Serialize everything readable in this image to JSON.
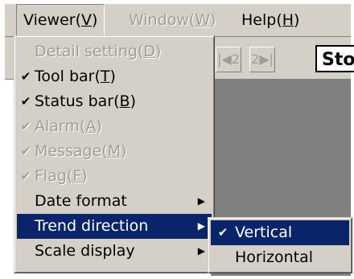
{
  "menubar": {
    "items": [
      {
        "label": "Viewer",
        "key": "V"
      },
      {
        "label": "Window",
        "key": "W"
      },
      {
        "label": "Help",
        "key": "H"
      }
    ]
  },
  "toolbar": {
    "nav_prev_label": "2",
    "nav_next_label": "2",
    "status_box_text": "Sto"
  },
  "viewer_menu": {
    "items": [
      {
        "label": "Detail setting",
        "key": "D",
        "checked": false,
        "enabled": false,
        "submenu": false
      },
      {
        "label": "Tool bar",
        "key": "T",
        "checked": true,
        "enabled": true,
        "submenu": false
      },
      {
        "label": "Status bar",
        "key": "B",
        "checked": true,
        "enabled": true,
        "submenu": false
      },
      {
        "label": "Alarm",
        "key": "A",
        "checked": true,
        "enabled": false,
        "submenu": false
      },
      {
        "label": "Message",
        "key": "M",
        "checked": true,
        "enabled": false,
        "submenu": false
      },
      {
        "label": "Flag",
        "key": "F",
        "checked": true,
        "enabled": false,
        "submenu": false
      },
      {
        "label": "Date format",
        "key": "",
        "checked": false,
        "enabled": true,
        "submenu": true
      },
      {
        "label": "Trend direction",
        "key": "",
        "checked": false,
        "enabled": true,
        "submenu": true,
        "selected": true
      },
      {
        "label": "Scale display",
        "key": "",
        "checked": false,
        "enabled": true,
        "submenu": true
      }
    ]
  },
  "trend_submenu": {
    "items": [
      {
        "label": "Vertical",
        "checked": true,
        "selected": true
      },
      {
        "label": "Horizontal",
        "checked": false,
        "selected": false
      }
    ]
  },
  "glyphs": {
    "check": "✔",
    "arrow": "▶",
    "open_paren": "(",
    "close_paren": ")"
  },
  "colors": {
    "menu_bg": "#d4d0c8",
    "highlight": "#0a246a",
    "disabled_text": "#a09d96"
  }
}
